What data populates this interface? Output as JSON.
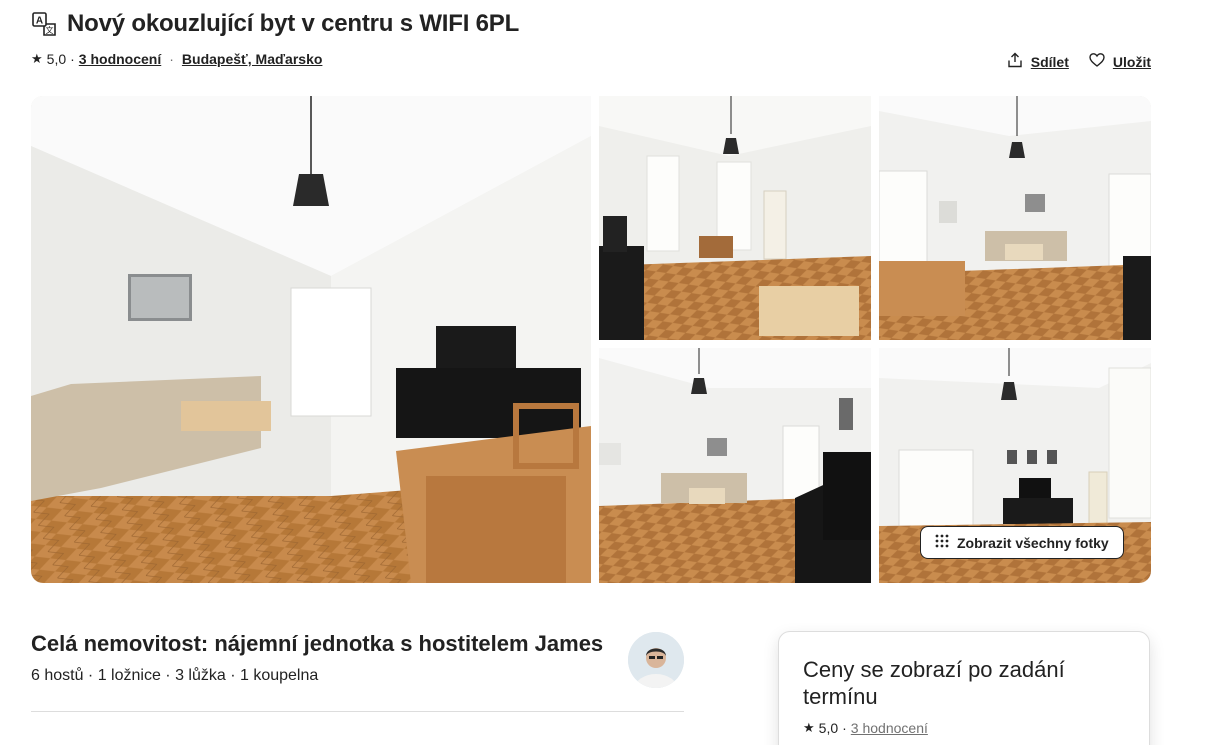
{
  "listing": {
    "title": "Nový okouzlující byt v centru s WIFI 6PL",
    "rating": "5,0",
    "reviews_link": "3 hodnocení",
    "location": "Budapešť, Maďarsko"
  },
  "actions": {
    "share_label": "Sdílet",
    "save_label": "Uložit"
  },
  "gallery": {
    "show_all_label": "Zobrazit všechny fotky"
  },
  "host": {
    "title": "Celá nemovitost: nájemní jednotka s hostitelem James",
    "details": "6 hostů · 1 ložnice · 3 lůžka · 1 koupelna"
  },
  "price_card": {
    "message": "Ceny se zobrazí po zadání termínu",
    "rating": "5,0",
    "reviews_link": "3 hodnocení"
  },
  "colors": {
    "text": "#222222",
    "muted": "#717171",
    "border": "#dddddd",
    "parquet": "#c9894a"
  }
}
